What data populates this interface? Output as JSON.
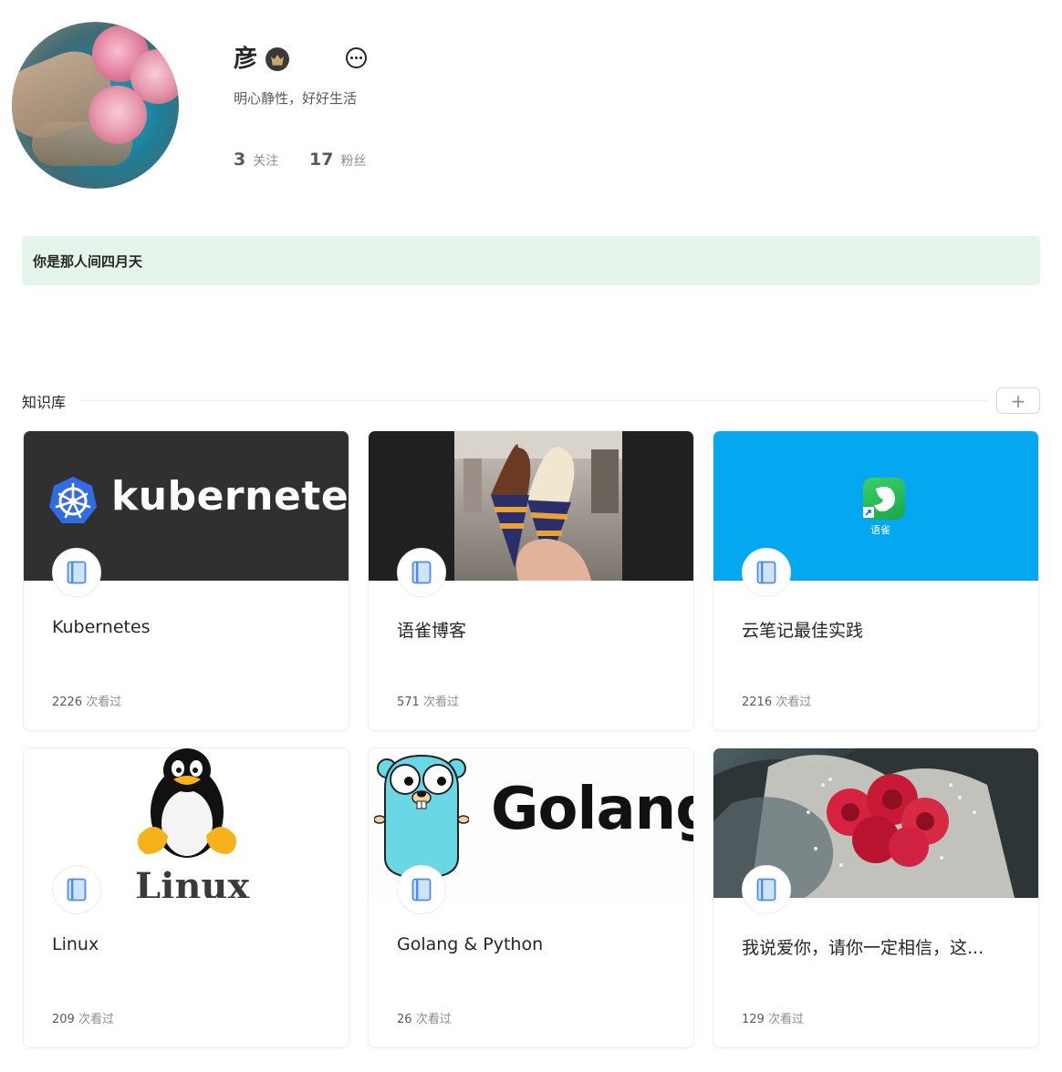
{
  "profile": {
    "name": "彦",
    "bio": "明心静性，好好生活",
    "following": {
      "count": "3",
      "label": "关注"
    },
    "followers": {
      "count": "17",
      "label": "粉丝"
    }
  },
  "banner": {
    "text": "你是那人间四月天"
  },
  "knowledge_base": {
    "title": "知识库",
    "add_label": "+",
    "views_suffix": "次看过",
    "cards": [
      {
        "title": "Kubernetes",
        "views": "2226",
        "cover_text": "kubernetes"
      },
      {
        "title": "语雀博客",
        "views": "571"
      },
      {
        "title": "云笔记最佳实践",
        "views": "2216",
        "cover_text": "语雀"
      },
      {
        "title": "Linux",
        "views": "209",
        "cover_text": "Linux"
      },
      {
        "title": "Golang & Python",
        "views": "26",
        "cover_text": "Golang"
      },
      {
        "title": "我说爱你，请你一定相信，这...",
        "views": "129"
      }
    ]
  },
  "colors": {
    "banner_bg": "#e5f5ec",
    "k8s_blue": "#326ce5",
    "yuque_blue": "#05a8f0",
    "gopher_cyan": "#6ad7e5"
  }
}
